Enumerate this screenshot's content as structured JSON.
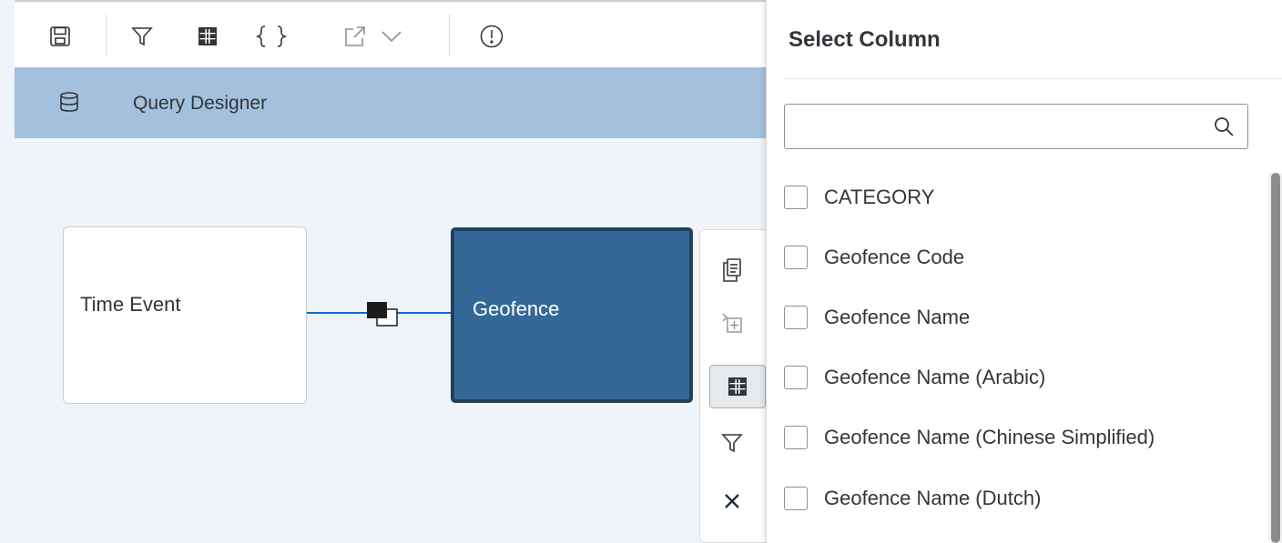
{
  "header": {
    "title": "Query Designer"
  },
  "nodes": {
    "time_event": "Time Event",
    "geofence": "Geofence"
  },
  "panel": {
    "title": "Select Column",
    "search": {
      "value": "",
      "placeholder": ""
    },
    "columns": [
      {
        "label": "CATEGORY",
        "checked": false
      },
      {
        "label": "Geofence Code",
        "checked": false
      },
      {
        "label": "Geofence Name",
        "checked": false
      },
      {
        "label": "Geofence Name (Arabic)",
        "checked": false
      },
      {
        "label": "Geofence Name (Chinese Simplified)",
        "checked": false
      },
      {
        "label": "Geofence Name (Dutch)",
        "checked": false
      }
    ]
  },
  "toolbar": {
    "icons": [
      "save-icon",
      "filter-icon",
      "columns-icon",
      "braces-icon",
      "export-icon",
      "chevron-down-icon",
      "info-icon"
    ]
  },
  "context_menu": {
    "icons": [
      "copy-icon",
      "add-join-icon",
      "columns-icon",
      "filter-icon",
      "close-icon"
    ],
    "active": "columns-icon"
  },
  "colors": {
    "accent": "#0a6ed1",
    "header_bar": "#a3c1dd",
    "selected_node": "#346896",
    "canvas": "#eff4f9"
  }
}
